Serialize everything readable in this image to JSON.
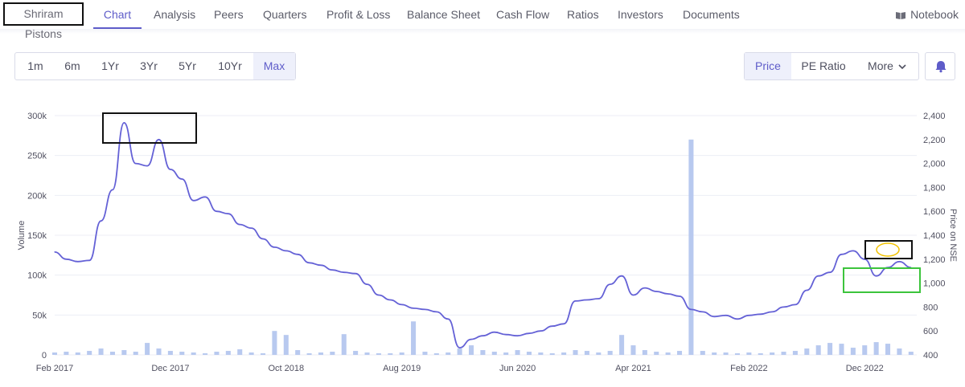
{
  "nav": {
    "company": "Shriram Pistons",
    "tabs": [
      "Chart",
      "Analysis",
      "Peers",
      "Quarters",
      "Profit & Loss",
      "Balance Sheet",
      "Cash Flow",
      "Ratios",
      "Investors",
      "Documents"
    ],
    "active_tab": "Chart",
    "notebook": "Notebook"
  },
  "ranges": [
    "1m",
    "6m",
    "1Yr",
    "3Yr",
    "5Yr",
    "10Yr",
    "Max"
  ],
  "active_range": "Max",
  "views": {
    "price": "Price",
    "pe": "PE Ratio",
    "more": "More",
    "active": "Price"
  },
  "colors": {
    "accent": "#5e5cc9",
    "price_line": "#6461d6",
    "volume_bar": "#b8c9ef"
  },
  "chart_data": {
    "type": "line",
    "xlabel": "",
    "ylabel_left": "Volume",
    "ylabel_right": "Price on NSE",
    "x_ticks": [
      "Feb 2017",
      "Dec 2017",
      "Oct 2018",
      "Aug 2019",
      "Jun 2020",
      "Apr 2021",
      "Feb 2022",
      "Dec 2022"
    ],
    "y_left_ticks": [
      "0",
      "50k",
      "100k",
      "150k",
      "200k",
      "250k",
      "300k"
    ],
    "y_left_range": [
      0,
      300000
    ],
    "y_right_ticks": [
      "400",
      "600",
      "800",
      "1,000",
      "1,200",
      "1,400",
      "1,600",
      "1,800",
      "2,000",
      "2,200",
      "2,400"
    ],
    "y_right_range": [
      400,
      2400
    ],
    "grid": true,
    "series": [
      {
        "kind": "line",
        "axis": "right",
        "x": [
          "2017-02",
          "2017-03",
          "2017-04",
          "2017-05",
          "2017-06",
          "2017-07",
          "2017-08",
          "2017-09",
          "2017-10",
          "2017-11",
          "2017-12",
          "2018-01",
          "2018-02",
          "2018-03",
          "2018-04",
          "2018-05",
          "2018-06",
          "2018-07",
          "2018-08",
          "2018-09",
          "2018-10",
          "2018-11",
          "2018-12",
          "2019-01",
          "2019-02",
          "2019-03",
          "2019-04",
          "2019-05",
          "2019-06",
          "2019-07",
          "2019-08",
          "2019-09",
          "2019-10",
          "2019-11",
          "2019-12",
          "2020-01",
          "2020-02",
          "2020-03",
          "2020-04",
          "2020-05",
          "2020-06",
          "2020-07",
          "2020-08",
          "2020-09",
          "2020-10",
          "2020-11",
          "2020-12",
          "2021-01",
          "2021-02",
          "2021-03",
          "2021-04",
          "2021-05",
          "2021-06",
          "2021-07",
          "2021-08",
          "2021-09",
          "2021-10",
          "2021-11",
          "2021-12",
          "2022-01",
          "2022-02",
          "2022-03",
          "2022-04",
          "2022-05",
          "2022-06",
          "2022-07",
          "2022-08",
          "2022-09",
          "2022-10",
          "2022-11",
          "2022-12",
          "2023-01",
          "2023-02",
          "2023-03",
          "2023-04"
        ],
        "values": [
          1260,
          1200,
          1180,
          1190,
          1520,
          1780,
          2340,
          2000,
          1980,
          2200,
          1950,
          1870,
          1690,
          1720,
          1600,
          1580,
          1490,
          1460,
          1370,
          1300,
          1270,
          1240,
          1170,
          1150,
          1110,
          1090,
          1080,
          990,
          900,
          860,
          820,
          790,
          780,
          760,
          700,
          460,
          530,
          560,
          590,
          570,
          560,
          580,
          600,
          640,
          660,
          850,
          860,
          870,
          990,
          1060,
          900,
          960,
          930,
          910,
          890,
          780,
          760,
          720,
          730,
          700,
          730,
          740,
          760,
          800,
          820,
          940,
          1060,
          1090,
          1240,
          1270,
          1200,
          1060,
          1130,
          1180,
          1130
        ]
      },
      {
        "kind": "bar",
        "axis": "left",
        "x": [
          "2017-02",
          "2017-03",
          "2017-04",
          "2017-05",
          "2017-06",
          "2017-07",
          "2017-08",
          "2017-09",
          "2017-10",
          "2017-11",
          "2017-12",
          "2018-01",
          "2018-02",
          "2018-03",
          "2018-04",
          "2018-05",
          "2018-06",
          "2018-07",
          "2018-08",
          "2018-09",
          "2018-10",
          "2018-11",
          "2018-12",
          "2019-01",
          "2019-02",
          "2019-03",
          "2019-04",
          "2019-05",
          "2019-06",
          "2019-07",
          "2019-08",
          "2019-09",
          "2019-10",
          "2019-11",
          "2019-12",
          "2020-01",
          "2020-02",
          "2020-03",
          "2020-04",
          "2020-05",
          "2020-06",
          "2020-07",
          "2020-08",
          "2020-09",
          "2020-10",
          "2020-11",
          "2020-12",
          "2021-01",
          "2021-02",
          "2021-03",
          "2021-04",
          "2021-05",
          "2021-06",
          "2021-07",
          "2021-08",
          "2021-09",
          "2021-10",
          "2021-11",
          "2021-12",
          "2022-01",
          "2022-02",
          "2022-03",
          "2022-04",
          "2022-05",
          "2022-06",
          "2022-07",
          "2022-08",
          "2022-09",
          "2022-10",
          "2022-11",
          "2022-12",
          "2023-01",
          "2023-02",
          "2023-03",
          "2023-04"
        ],
        "values": [
          3000,
          4000,
          3000,
          5000,
          8000,
          4000,
          6000,
          4000,
          15000,
          8000,
          5000,
          4000,
          3000,
          2000,
          4000,
          5000,
          7000,
          3000,
          2000,
          30000,
          25000,
          6000,
          2000,
          3000,
          4000,
          26000,
          5000,
          3000,
          2000,
          2000,
          3000,
          42000,
          4000,
          2000,
          3000,
          8000,
          12000,
          6000,
          4000,
          3000,
          6000,
          4000,
          3000,
          2000,
          3000,
          6000,
          5000,
          3000,
          5000,
          25000,
          12000,
          6000,
          4000,
          3000,
          5000,
          270000,
          5000,
          3000,
          3000,
          2000,
          3000,
          2000,
          3000,
          4000,
          5000,
          8000,
          12000,
          15000,
          14000,
          9000,
          12000,
          16000,
          14000,
          8000,
          4000
        ]
      }
    ]
  }
}
